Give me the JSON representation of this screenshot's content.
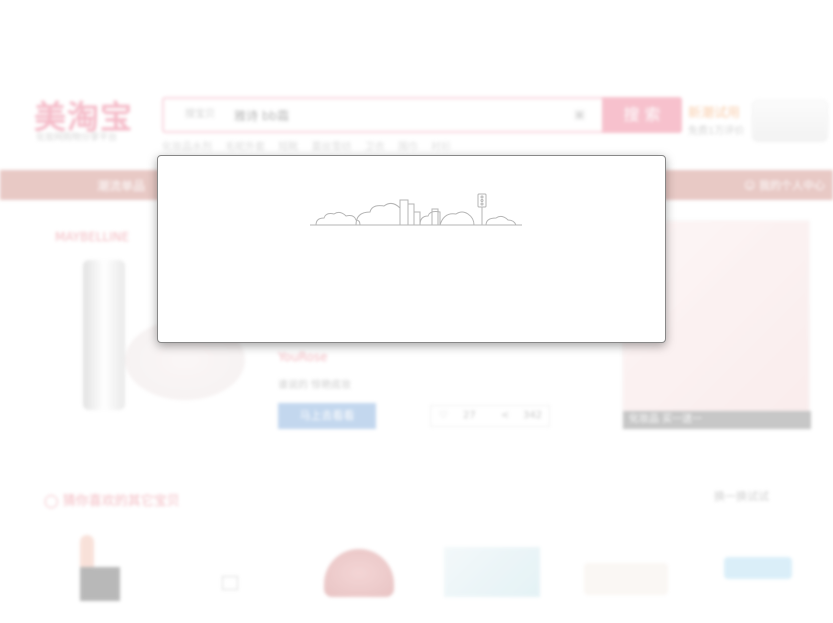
{
  "header": {
    "logo_text": "美淘宝",
    "logo_subtitle": "化妆网购物分享平台",
    "search": {
      "type_label": "搜宝贝",
      "query": "雅诗 bb霜",
      "button_label": "搜 索"
    },
    "hot_words": [
      "化妆品水剂",
      "毛呢外套",
      "短靴",
      "蕾丝雪纺",
      "卫衣",
      "围巾",
      "衬衫"
    ],
    "promo": {
      "title": "新潮试用",
      "subtitle": "免费1万评价"
    }
  },
  "nav": {
    "items": [
      "",
      "潮流单品"
    ],
    "user_label": "我的个人中心"
  },
  "banner": {
    "left_brand": "MAYBELLINE",
    "mid_brand": "YouRose",
    "mid_subtitle": "谁说的  惊艳底妆",
    "mid_button": "马上去看看",
    "pager_left": "27",
    "pager_right": "342",
    "right_caption": "化妆品  买一送一"
  },
  "recommend": {
    "title": "猜你喜欢的其它宝贝",
    "refresh_label": "换一换试试"
  },
  "dialog": {
    "illustration": "city-skyline-icon"
  }
}
